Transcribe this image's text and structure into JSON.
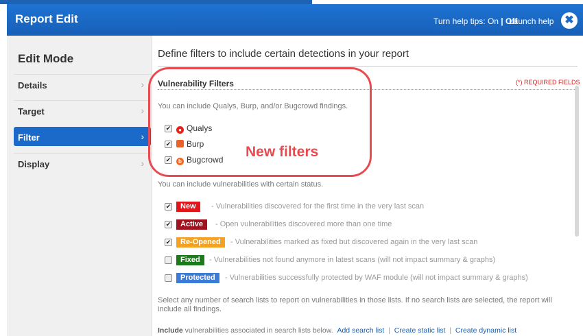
{
  "window": {
    "title": "Report Edit",
    "help_tips_label": "Turn help tips:",
    "help_on": "On",
    "help_sep": "|",
    "help_off": "Off",
    "launch_help": "Launch help",
    "close_symbol": "✖"
  },
  "sidebar": {
    "mode_title": "Edit Mode",
    "items": [
      {
        "label": "Details",
        "active": false
      },
      {
        "label": "Target",
        "active": false
      },
      {
        "label": "Filter",
        "active": true
      },
      {
        "label": "Display",
        "active": false
      }
    ]
  },
  "main": {
    "heading": "Define filters to include certain detections in your report",
    "section_title": "Vulnerability Filters",
    "required_note": "(*) REQUIRED FIELDS",
    "sources_intro": "You can include Qualys, Burp, and/or Bugcrowd findings.",
    "sources": [
      {
        "label": "Qualys",
        "checked": true,
        "icon": "qualys-shield-icon",
        "color": "#e2231a"
      },
      {
        "label": "Burp",
        "checked": true,
        "icon": "burp-icon",
        "color": "#e8622a"
      },
      {
        "label": "Bugcrowd",
        "checked": true,
        "icon": "bugcrowd-icon",
        "color": "#f26822"
      }
    ],
    "annotation": "New filters",
    "status_intro": "You can include vulnerabilities with certain status.",
    "statuses": [
      {
        "badge": "New",
        "color": "#e0161b",
        "checked": true,
        "desc": "- Vulnerabilities discovered for the first time in the very last scan"
      },
      {
        "badge": "Active",
        "color": "#a0121e",
        "checked": true,
        "desc": "- Open vulnerabilities discovered more than one time"
      },
      {
        "badge": "Re-Opened",
        "color": "#f4a223",
        "checked": true,
        "desc": "- Vulnerabilities marked as fixed but discovered again in the very last scan"
      },
      {
        "badge": "Fixed",
        "color": "#1c7a1c",
        "checked": false,
        "desc": "- Vulnerabilities not found anymore in latest scans (will not impact summary & graphs)"
      },
      {
        "badge": "Protected",
        "color": "#3c7bd6",
        "checked": false,
        "desc": "- Vulnerabilities successfully protected by WAF module (will not impact summary & graphs)"
      }
    ],
    "search_lists_text_1": "Select any number of search lists to report on vulnerabilities in those lists. If no search lists are selected, the report will",
    "search_lists_text_2": "include all findings.",
    "include_bold": "Include",
    "include_rest": " vulnerabilities associated in search lists below.",
    "add_search_list": "Add search list",
    "create_static_list": "Create static list",
    "create_dynamic_list": "Create dynamic list",
    "link_sep": "|"
  }
}
